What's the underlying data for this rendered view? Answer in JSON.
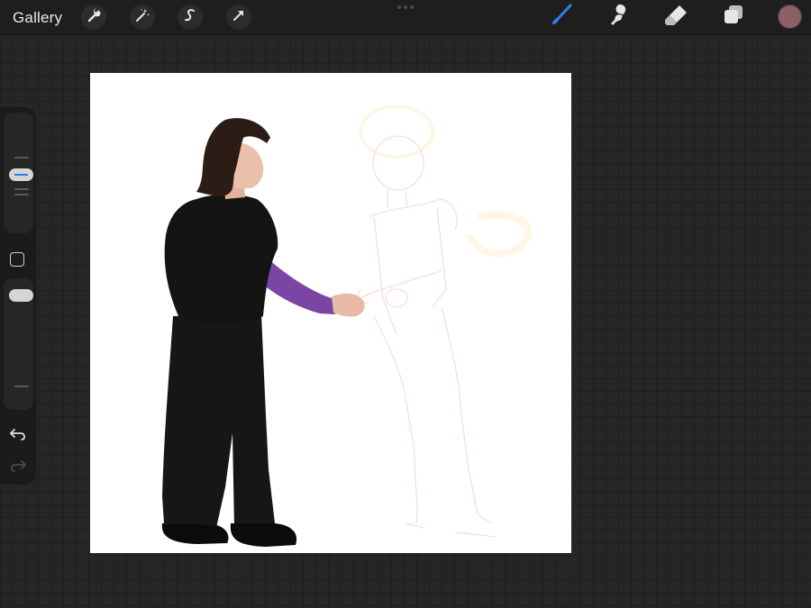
{
  "topbar": {
    "gallery_label": "Gallery",
    "left_tools": [
      "wrench-icon",
      "magic-wand-icon",
      "selection-s-icon",
      "transform-arrow-icon"
    ],
    "right_tools": [
      "brush-icon",
      "smudge-icon",
      "eraser-icon",
      "layers-icon"
    ],
    "active_tool": "brush-icon",
    "active_color": "#8d5f66",
    "accent_color": "#2f7ef3"
  },
  "sidebar": {
    "controls": [
      "brush-size-slider",
      "modify-button",
      "opacity-slider",
      "undo-icon",
      "redo-icon"
    ]
  },
  "canvas": {
    "background": "#ffffff",
    "layers": [
      "painted-figure",
      "faint-sketch-figure"
    ]
  }
}
